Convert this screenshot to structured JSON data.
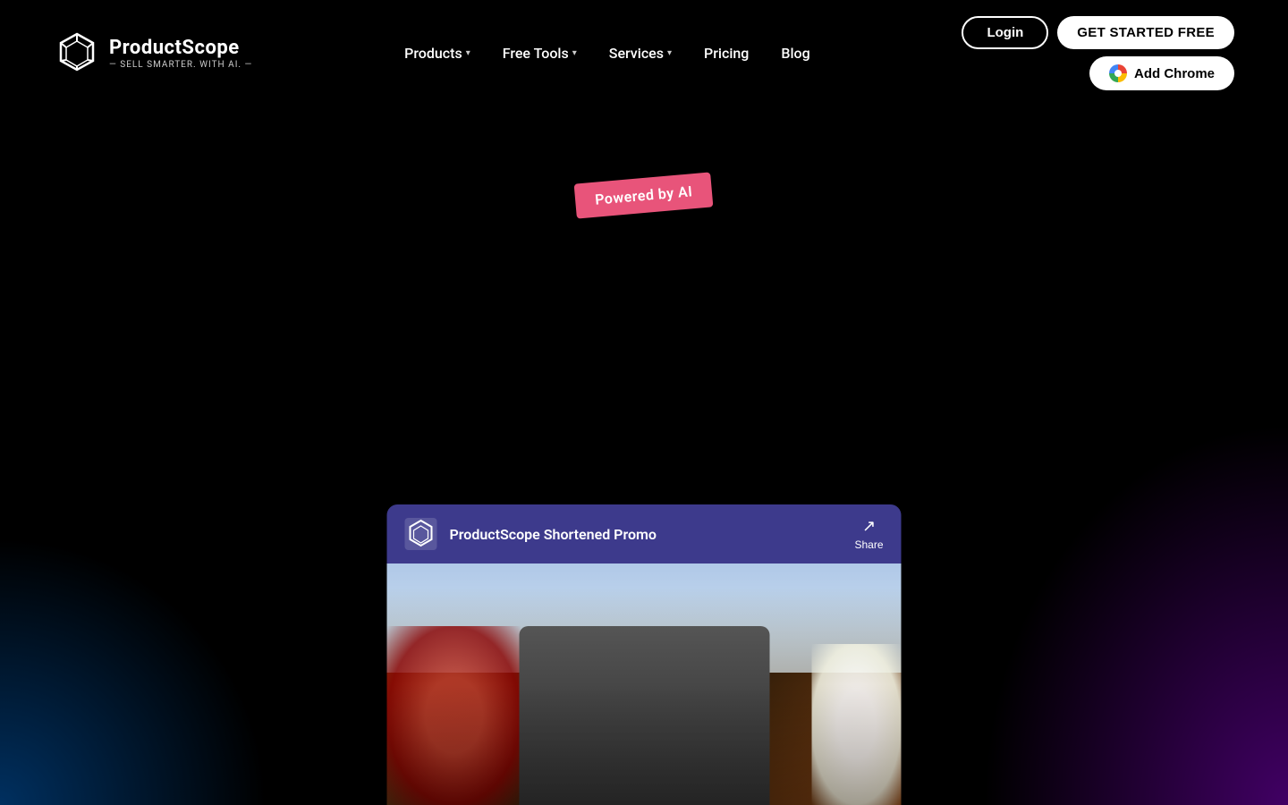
{
  "site": {
    "name": "ProductScope",
    "tagline": "— SELL SMARTER. WITH AI. —"
  },
  "nav": {
    "links": [
      {
        "id": "products",
        "label": "Products",
        "hasDropdown": true
      },
      {
        "id": "free-tools",
        "label": "Free Tools",
        "hasDropdown": true
      },
      {
        "id": "services",
        "label": "Services",
        "hasDropdown": true
      },
      {
        "id": "pricing",
        "label": "Pricing",
        "hasDropdown": false
      },
      {
        "id": "blog",
        "label": "Blog",
        "hasDropdown": false
      }
    ],
    "loginLabel": "Login",
    "getStartedLabel": "GET STARTED FREE",
    "addChromeLabel": "Add Chrome"
  },
  "hero": {
    "badge": "Powered by AI"
  },
  "video": {
    "channelName": "ProductScope Shortened Promo",
    "shareLabel": "Share"
  },
  "colors": {
    "accent": "#e8547a",
    "navBg": "transparent",
    "buttonBg": "#fff",
    "videoHeaderBg": "#3d3a8c"
  }
}
